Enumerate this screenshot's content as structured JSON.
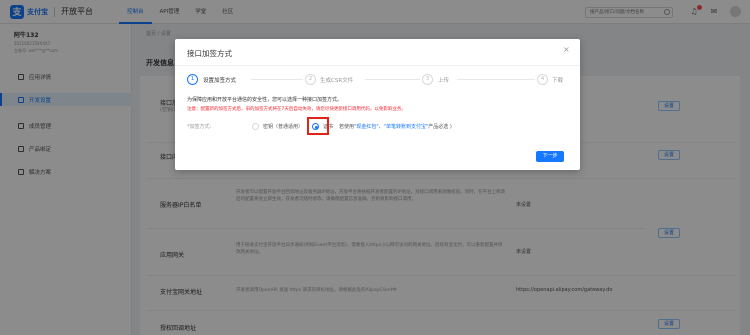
{
  "brand": {
    "logo_text": "支付宝",
    "app_title": "开放平台"
  },
  "nav": [
    "控制台",
    "API管理",
    "学堂",
    "社区"
  ],
  "search": {
    "placeholder": "搜产品/接口/问题/文档名称"
  },
  "account": {
    "name": "阿牛132",
    "line1": "2021002159XXX7",
    "line2": "主账号: wei***@**com"
  },
  "sidebar": [
    "应用详情",
    "开发设置",
    "成员管理",
    "产品绑定",
    "解决方案"
  ],
  "breadcrumb": "首页 / 设置",
  "main": {
    "section_title": "开发信息",
    "rows": [
      {
        "title": "接口加签方式",
        "sub": "(密钥/证书)",
        "desc": "",
        "status": "",
        "button": "设置"
      },
      {
        "title": "接口内容加密方式",
        "desc": "",
        "status": "",
        "button": "设置"
      },
      {
        "title": "服务器IP白名单",
        "desc": "开发者可以配置开放平台回调地址及服务器IP地址，开放平台将依据开发者配置的IP地址，对接口调用来源做校验。同时，在平台上修改后的配置将会立即生效，开发者可随时修改。请确保配置信息准确，否则将影响接口调用。",
        "status": "未设置",
        "button": "设置"
      },
      {
        "title": "应用网关",
        "desc": "用于接收支付宝开放平台异步通知(例如Event平台消息)，需要接入https://公网可访问的网关地址，后续有变化时，可以重新配置并修改网关地址。",
        "status": "未设置",
        "button": "设置"
      },
      {
        "title": "支付宝网关地址",
        "desc": "开发者调用OpenAPI 发送 https 请求的目标地址，请根据此处的AlipayClient中",
        "status": "https://openapi.alipay.com/gateway.do",
        "button": ""
      },
      {
        "title": "授权回调地址",
        "desc": "",
        "status": "",
        "button": "设置"
      }
    ]
  },
  "modal": {
    "title": "接口加签方式",
    "close": "×",
    "steps": [
      {
        "num": "1",
        "label": "设置加签方式"
      },
      {
        "num": "2",
        "label": "生成CSR文件"
      },
      {
        "num": "3",
        "label": "上传"
      },
      {
        "num": "4",
        "label": "下载"
      }
    ],
    "info": "为保障应用和开放平台通信的安全性，您可以选择一种接口加签方式。",
    "warning": "注意：配置新的加签方式后，旧的加签方式将在7天后自动失效，请您尽快更新接口调用代码，以免影响业务。",
    "form_label": "*加签方式:",
    "option_key": "密钥（普通适用）",
    "option_cert": "证书",
    "cert_note_prefix": "若使用",
    "cert_link1": "\"现金红包\"",
    "cert_sep": "、",
    "cert_link2": "\"单笔转账到支付宝\"",
    "cert_note_suffix": "产品必选 )",
    "next_button": "下一步"
  },
  "colors": {
    "accent": "#1677ff",
    "warning": "#f5222d",
    "highlight": "#e0241a"
  }
}
